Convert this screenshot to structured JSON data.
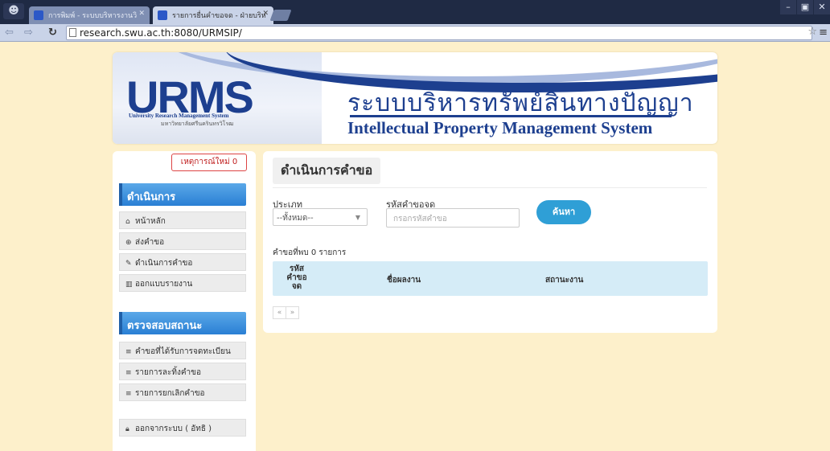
{
  "browser": {
    "tabs": [
      {
        "title": "การพิมพ์ - ระบบบริหารงานวิ"
      },
      {
        "title": "รายการยื่นคำขอจด - ฝ่ายบริห"
      }
    ],
    "url": "research.swu.ac.th:8080/URMSIP/"
  },
  "banner": {
    "logo": "URMS",
    "logo_sub": "University Research Management System",
    "logo_sub2": "มหาวิทยาลัยศรีนครินทรวิโรฒ",
    "title_th": "ระบบบริหารทรัพย์สินทางปัญญา",
    "title_en": "Intellectual Property Management System"
  },
  "sidebar": {
    "new_events": "เหตุการณ์ใหม่ 0",
    "section1": "ดำเนินการ",
    "items1": [
      {
        "icon": "home-icon",
        "glyph": "⌂",
        "label": "หน้าหลัก"
      },
      {
        "icon": "send-icon",
        "glyph": "⊕",
        "label": "ส่งคำขอ"
      },
      {
        "icon": "wrench-icon",
        "glyph": "✎",
        "label": "ดำเนินการคำขอ"
      },
      {
        "icon": "chart-icon",
        "glyph": "▥",
        "label": "ออกแบบรายงาน"
      }
    ],
    "section2": "ตรวจสอบสถานะ",
    "items2": [
      {
        "icon": "list-icon",
        "glyph": "≡",
        "label": "คำขอที่ได้รับการจดทะเบียน"
      },
      {
        "icon": "list-icon",
        "glyph": "≡",
        "label": "รายการละทิ้งคำขอ"
      },
      {
        "icon": "list-icon",
        "glyph": "≡",
        "label": "รายการยกเลิกคำขอ"
      }
    ],
    "logout": "ออกจากระบบ ( อัทธิ )"
  },
  "main": {
    "page_title": "ดำเนินการคำขอ",
    "type_label": "ประเภท",
    "type_value": "--ทั้งหมด--",
    "code_label": "รหัสคำขอจด",
    "code_placeholder": "กรอกรหัสคำขอ",
    "search_button": "ค้นหา",
    "result_count": "คำขอที่พบ 0 รายการ",
    "table_headers": [
      "รหัส คำขอ จด",
      "ชื่อผลงาน",
      "สถานะงาน"
    ],
    "pager": [
      "«",
      "»"
    ]
  }
}
